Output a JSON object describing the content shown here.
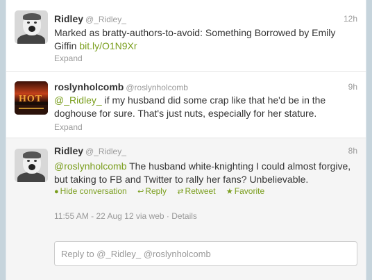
{
  "tweets": [
    {
      "name": "Ridley",
      "handle": "@_Ridley_",
      "time": "12h",
      "text_plain": "Marked as bratty-authors-to-avoid: Something Borrowed by Emily Giffin ",
      "link": "bit.ly/O1N9Xr",
      "expand": "Expand"
    },
    {
      "name": "roslynholcomb",
      "handle": "@roslynholcomb",
      "time": "9h",
      "mention": "@_Ridley_",
      "text_plain": " if my husband did some crap like that he'd be in the doghouse for sure. That's just nuts, especially for her stature.",
      "expand": "Expand",
      "avatar_text": "HOT"
    },
    {
      "name": "Ridley",
      "handle": "@_Ridley_",
      "time": "8h",
      "mention": "@roslynholcomb",
      "text_plain": " The husband white-knighting I could almost forgive, but taking to FB and Twitter to rally her fans? Unbelievable.",
      "actions": {
        "hide": "Hide conversation",
        "reply": "Reply",
        "retweet": "Retweet",
        "favorite": "Favorite"
      },
      "details_time": "11:55 AM - 22 Aug 12 via web",
      "details_sep": " · ",
      "details_link": "Details",
      "reply_placeholder": "Reply to @_Ridley_ @roslynholcomb"
    }
  ],
  "colors": {
    "link": "#7a9e1d",
    "muted": "#999999",
    "background": "#c6d4dc"
  },
  "icons": {
    "hide": "speech-bubble-icon",
    "reply": "reply-arrow-icon",
    "retweet": "retweet-icon",
    "favorite": "star-icon"
  }
}
